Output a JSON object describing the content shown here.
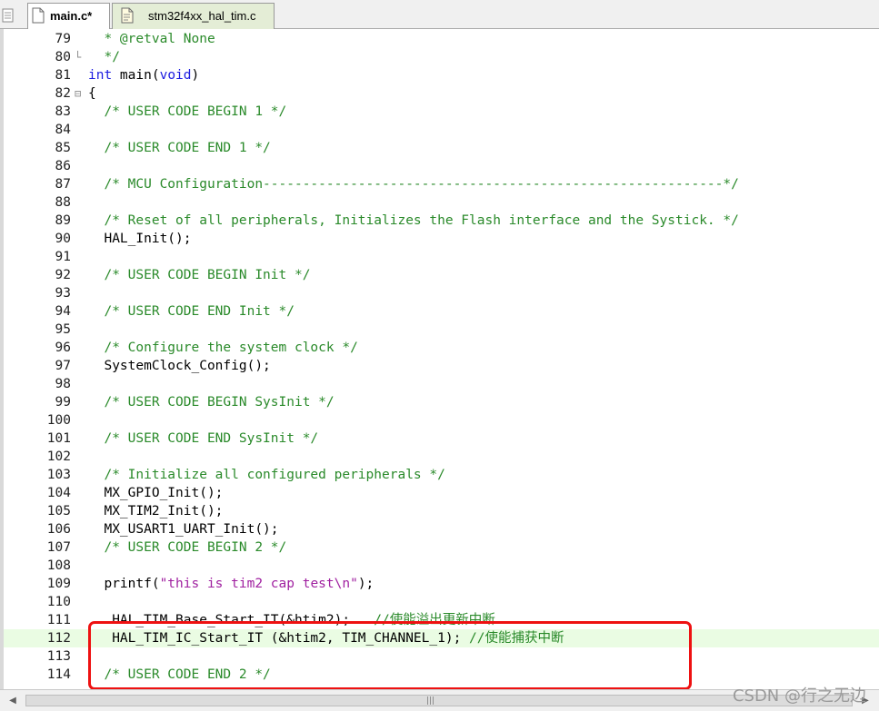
{
  "tabs": [
    {
      "label": "main.c*",
      "active": true
    },
    {
      "label": "stm32f4xx_hal_tim.c",
      "active": false
    }
  ],
  "lines": [
    {
      "num": "79",
      "fold": "",
      "segs": [
        {
          "t": "  * @retval None",
          "c": "cm"
        }
      ]
    },
    {
      "num": "80",
      "fold": "└",
      "segs": [
        {
          "t": "  */",
          "c": "cm"
        }
      ]
    },
    {
      "num": "81",
      "fold": "",
      "segs": [
        {
          "t": "int",
          "c": "kw"
        },
        {
          "t": " main(",
          "c": ""
        },
        {
          "t": "void",
          "c": "kw"
        },
        {
          "t": ")",
          "c": ""
        }
      ]
    },
    {
      "num": "82",
      "fold": "⊟",
      "segs": [
        {
          "t": "{",
          "c": ""
        }
      ]
    },
    {
      "num": "83",
      "fold": "",
      "segs": [
        {
          "t": "  /* USER CODE BEGIN 1 */",
          "c": "cm"
        }
      ]
    },
    {
      "num": "84",
      "fold": "",
      "segs": []
    },
    {
      "num": "85",
      "fold": "",
      "segs": [
        {
          "t": "  /* USER CODE END 1 */",
          "c": "cm"
        }
      ]
    },
    {
      "num": "86",
      "fold": "",
      "segs": []
    },
    {
      "num": "87",
      "fold": "",
      "segs": [
        {
          "t": "  /* MCU Configuration----------------------------------------------------------*/",
          "c": "cm"
        }
      ]
    },
    {
      "num": "88",
      "fold": "",
      "segs": []
    },
    {
      "num": "89",
      "fold": "",
      "segs": [
        {
          "t": "  /* Reset of all peripherals, Initializes the Flash interface and the Systick. */",
          "c": "cm"
        }
      ]
    },
    {
      "num": "90",
      "fold": "",
      "segs": [
        {
          "t": "  HAL_Init();",
          "c": ""
        }
      ]
    },
    {
      "num": "91",
      "fold": "",
      "segs": []
    },
    {
      "num": "92",
      "fold": "",
      "segs": [
        {
          "t": "  /* USER CODE BEGIN Init */",
          "c": "cm"
        }
      ]
    },
    {
      "num": "93",
      "fold": "",
      "segs": []
    },
    {
      "num": "94",
      "fold": "",
      "segs": [
        {
          "t": "  /* USER CODE END Init */",
          "c": "cm"
        }
      ]
    },
    {
      "num": "95",
      "fold": "",
      "segs": []
    },
    {
      "num": "96",
      "fold": "",
      "segs": [
        {
          "t": "  /* Configure the system clock */",
          "c": "cm"
        }
      ]
    },
    {
      "num": "97",
      "fold": "",
      "segs": [
        {
          "t": "  SystemClock_Config();",
          "c": ""
        }
      ]
    },
    {
      "num": "98",
      "fold": "",
      "segs": []
    },
    {
      "num": "99",
      "fold": "",
      "segs": [
        {
          "t": "  /* USER CODE BEGIN SysInit */",
          "c": "cm"
        }
      ]
    },
    {
      "num": "100",
      "fold": "",
      "segs": []
    },
    {
      "num": "101",
      "fold": "",
      "segs": [
        {
          "t": "  /* USER CODE END SysInit */",
          "c": "cm"
        }
      ]
    },
    {
      "num": "102",
      "fold": "",
      "segs": []
    },
    {
      "num": "103",
      "fold": "",
      "segs": [
        {
          "t": "  /* Initialize all configured peripherals */",
          "c": "cm"
        }
      ]
    },
    {
      "num": "104",
      "fold": "",
      "segs": [
        {
          "t": "  MX_GPIO_Init();",
          "c": ""
        }
      ]
    },
    {
      "num": "105",
      "fold": "",
      "segs": [
        {
          "t": "  MX_TIM2_Init();",
          "c": ""
        }
      ]
    },
    {
      "num": "106",
      "fold": "",
      "segs": [
        {
          "t": "  MX_USART1_UART_Init();",
          "c": ""
        }
      ]
    },
    {
      "num": "107",
      "fold": "",
      "segs": [
        {
          "t": "  /* USER CODE BEGIN 2 */",
          "c": "cm"
        }
      ]
    },
    {
      "num": "108",
      "fold": "",
      "segs": []
    },
    {
      "num": "109",
      "fold": "",
      "segs": [
        {
          "t": "  printf(",
          "c": ""
        },
        {
          "t": "\"this is tim2 cap test\\n\"",
          "c": "str"
        },
        {
          "t": ");",
          "c": ""
        }
      ]
    },
    {
      "num": "110",
      "fold": "",
      "segs": []
    },
    {
      "num": "111",
      "fold": "",
      "segs": [
        {
          "t": "   HAL_TIM_Base_Start_IT(&htim2);   ",
          "c": ""
        },
        {
          "t": "//使能溢出更新中断",
          "c": "cm"
        }
      ]
    },
    {
      "num": "112",
      "fold": "",
      "hl": true,
      "segs": [
        {
          "t": "   HAL_TIM_IC_Start_IT (&htim2, TIM_CHANNEL_1); ",
          "c": ""
        },
        {
          "t": "//使能捕获中断",
          "c": "cm"
        }
      ]
    },
    {
      "num": "113",
      "fold": "",
      "segs": []
    },
    {
      "num": "114",
      "fold": "",
      "segs": [
        {
          "t": "  /* USER CODE END 2 */",
          "c": "cm"
        }
      ]
    }
  ],
  "colors": {
    "comment": "#2a8a2a",
    "keyword": "#1c1ce0",
    "string": "#a020a0",
    "highlight": "#eafce3",
    "annotation_box": "#ee1111"
  },
  "watermark": "CSDN @行之无边"
}
